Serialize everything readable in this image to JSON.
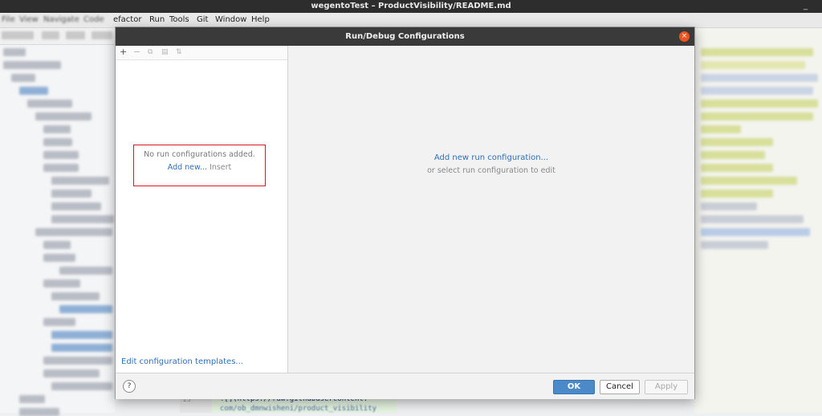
{
  "window": {
    "title": "wegentoTest – ProductVisibility/README.md",
    "minimize_glyph": "_"
  },
  "menubar": {
    "items": [
      "File",
      "View",
      "Navigate",
      "Code",
      "Refactor",
      "Run",
      "Tools",
      "Git",
      "Window",
      "Help"
    ],
    "visible": {
      "refactor": "efactor",
      "run": "Run",
      "tools": "Tools",
      "git": "Git",
      "window": "Window",
      "help": "Help"
    }
  },
  "editor": {
    "line_number": "23",
    "line1": "![](https://raw.githubusercontent.",
    "line2": "com/ob_dmnwisheni/product_visibility"
  },
  "dialog": {
    "title": "Run/Debug Configurations",
    "close_glyph": "×",
    "toolbar": {
      "add": "+",
      "remove": "−",
      "copy": "⧉",
      "save": "▤",
      "sort": "⇅"
    },
    "left": {
      "empty_text": "No run configurations added.",
      "add_new_link": "Add new...",
      "insert_hint": "Insert",
      "edit_templates": "Edit configuration templates..."
    },
    "right": {
      "add_run_config": "Add new run configuration...",
      "select_hint": "or select run configuration to edit"
    },
    "footer": {
      "help": "?",
      "ok": "OK",
      "cancel": "Cancel",
      "apply": "Apply"
    }
  },
  "colors": {
    "accent": "#2f6fb8",
    "ok_button": "#4b89c8",
    "close_button": "#e95420",
    "highlight_box": "#d9191e"
  }
}
